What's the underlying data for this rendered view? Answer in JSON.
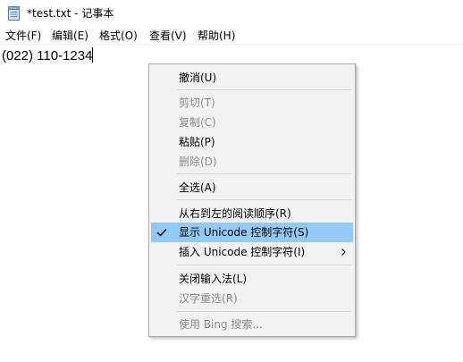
{
  "window": {
    "title": "*test.txt - 记事本",
    "icon": "notepad-icon"
  },
  "menubar": {
    "items": [
      {
        "label": "文件(F)"
      },
      {
        "label": "编辑(E)"
      },
      {
        "label": "格式(O)"
      },
      {
        "label": "查看(V)"
      },
      {
        "label": "帮助(H)"
      }
    ]
  },
  "editor": {
    "content": "(022) 110-1234"
  },
  "context_menu": {
    "items": [
      {
        "label": "撤消(U)",
        "enabled": true
      },
      {
        "label": "剪切(T)",
        "enabled": false
      },
      {
        "label": "复制(C)",
        "enabled": false
      },
      {
        "label": "粘贴(P)",
        "enabled": true
      },
      {
        "label": "删除(D)",
        "enabled": false
      },
      {
        "label": "全选(A)",
        "enabled": true
      },
      {
        "label": "从右到左的阅读顺序(R)",
        "enabled": true
      },
      {
        "label": "显示 Unicode 控制字符(S)",
        "enabled": true,
        "checked": true,
        "highlighted": true
      },
      {
        "label": "插入 Unicode 控制字符(I)",
        "enabled": true,
        "submenu": true
      },
      {
        "label": "关闭输入法(L)",
        "enabled": true
      },
      {
        "label": "汉字重选(R)",
        "enabled": false
      },
      {
        "label": "使用 Bing 搜索...",
        "enabled": false
      }
    ]
  },
  "colors": {
    "highlight": "#91c9f7",
    "menu_background": "#f2f2f2",
    "disabled_text": "#8d8d8d",
    "border": "#a9a9a9"
  }
}
